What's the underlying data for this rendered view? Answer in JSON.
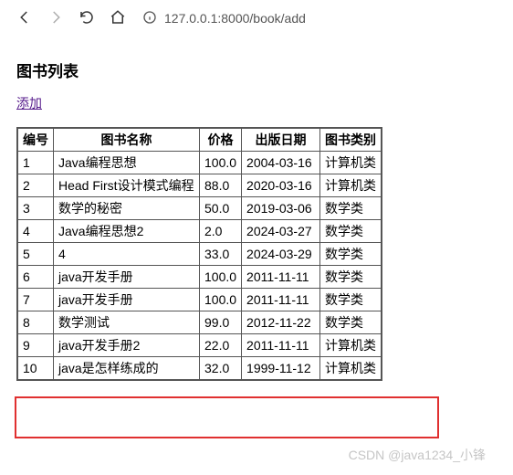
{
  "browser": {
    "url": "127.0.0.1:8000/book/add"
  },
  "page": {
    "title": "图书列表",
    "add_link": "添加"
  },
  "table": {
    "headers": {
      "id": "编号",
      "name": "图书名称",
      "price": "价格",
      "date": "出版日期",
      "category": "图书类别"
    },
    "rows": [
      {
        "id": "1",
        "name": "Java编程思想",
        "price": "100.0",
        "date": "2004-03-16",
        "category": "计算机类"
      },
      {
        "id": "2",
        "name": "Head First设计模式编程",
        "price": "88.0",
        "date": "2020-03-16",
        "category": "计算机类"
      },
      {
        "id": "3",
        "name": "数学的秘密",
        "price": "50.0",
        "date": "2019-03-06",
        "category": "数学类"
      },
      {
        "id": "4",
        "name": "Java编程思想2",
        "price": "2.0",
        "date": "2024-03-27",
        "category": "数学类"
      },
      {
        "id": "5",
        "name": "4",
        "price": "33.0",
        "date": "2024-03-29",
        "category": "数学类"
      },
      {
        "id": "6",
        "name": "java开发手册",
        "price": "100.0",
        "date": "2011-11-11",
        "category": "数学类"
      },
      {
        "id": "7",
        "name": "java开发手册",
        "price": "100.0",
        "date": "2011-11-11",
        "category": "数学类"
      },
      {
        "id": "8",
        "name": "数学测试",
        "price": "99.0",
        "date": "2012-11-22",
        "category": "数学类"
      },
      {
        "id": "9",
        "name": "java开发手册2",
        "price": "22.0",
        "date": "2011-11-11",
        "category": "计算机类"
      },
      {
        "id": "10",
        "name": "java是怎样练成的",
        "price": "32.0",
        "date": "1999-11-12",
        "category": "计算机类"
      }
    ]
  },
  "watermark": "CSDN @java1234_小锋"
}
